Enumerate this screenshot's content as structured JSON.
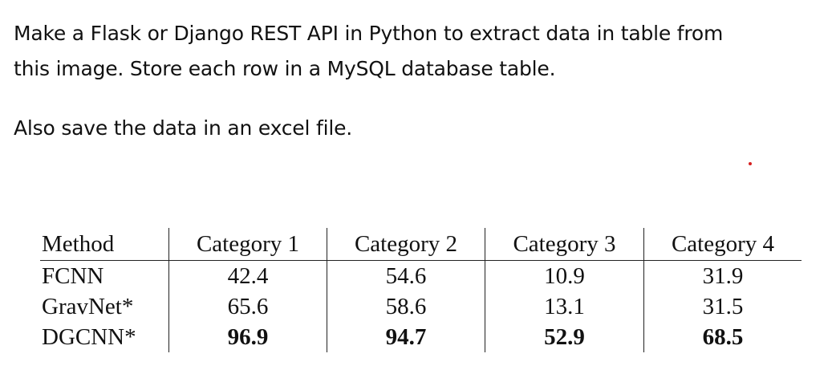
{
  "prompt": {
    "line1": "Make a Flask or Django REST API in Python to extract data in table from",
    "line2": "this image. Store each row in a MySQL database table.",
    "line3": "Also save the data in an excel file."
  },
  "table": {
    "headers": [
      "Method",
      "Category 1",
      "Category 2",
      "Category 3",
      "Category 4"
    ],
    "rows": [
      {
        "method": "FCNN",
        "values": [
          "42.4",
          "54.6",
          "10.9",
          "31.9"
        ],
        "bold": false
      },
      {
        "method": "GravNet*",
        "values": [
          "65.6",
          "58.6",
          "13.1",
          "31.5"
        ],
        "bold": false
      },
      {
        "method": "DGCNN*",
        "values": [
          "96.9",
          "94.7",
          "52.9",
          "68.5"
        ],
        "bold": true
      }
    ]
  },
  "colors": {
    "text": "#111111",
    "dot": "#d62020",
    "background": "#ffffff"
  }
}
